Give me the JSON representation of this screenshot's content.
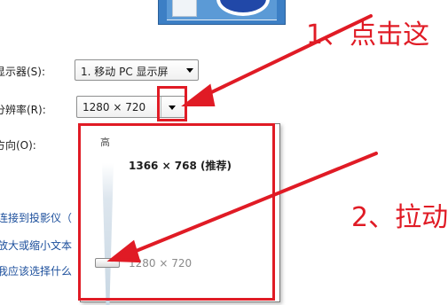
{
  "display": {
    "monitor_label": "显示器(S):",
    "monitor_value": "1. 移动 PC 显示屏",
    "resolution_label": "分辨率(R):",
    "resolution_value": "1280 × 720",
    "orientation_label": "方向(O):"
  },
  "links": {
    "projector": "连接到投影仪（",
    "zoom_text": "放大或缩小文本",
    "which_settings": "我应该选择什么"
  },
  "resolution_popup": {
    "high_label": "高",
    "recommended": "1366 × 768 (推荐)",
    "current": "1280 × 720"
  },
  "annotations": {
    "step1": "1、点击这",
    "step2": "2、拉动",
    "color": "#e01b25"
  }
}
